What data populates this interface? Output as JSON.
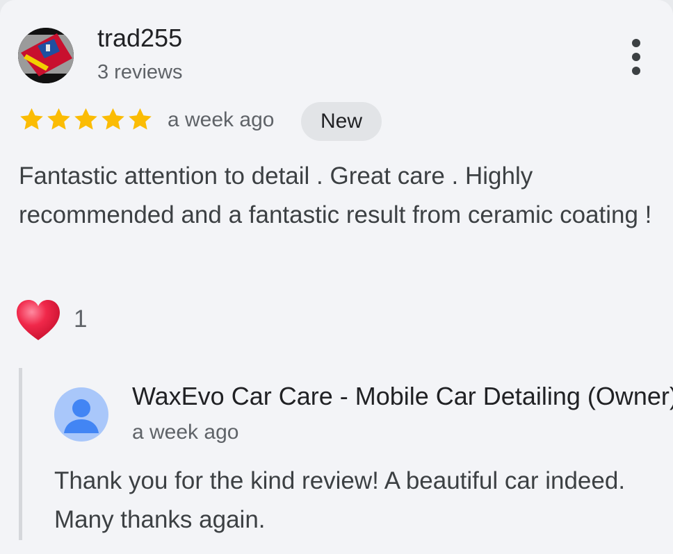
{
  "review": {
    "author": "trad255",
    "author_reviews": "3 reviews",
    "rating": 5,
    "rating_max": 5,
    "time": "a week ago",
    "badge": "New",
    "text": "Fantastic attention to detail . Great care . Highly recommended and a fantastic result from ceramic coating !",
    "likes": "1",
    "icons": {
      "more": "more-vert-icon",
      "like": "heart-icon",
      "star": "star-icon",
      "owner_avatar": "person-icon"
    }
  },
  "owner_response": {
    "name": "WaxEvo Car Care - Mobile Car Detailing (Owner)",
    "time": "a week ago",
    "text": "Thank you for the kind review! A beautiful car indeed. Many thanks again."
  },
  "colors": {
    "star": "#fbbc04",
    "heart": "#f0284a",
    "owner_avatar_bg": "#a9c7fa",
    "owner_avatar_fg": "#4285f4"
  }
}
